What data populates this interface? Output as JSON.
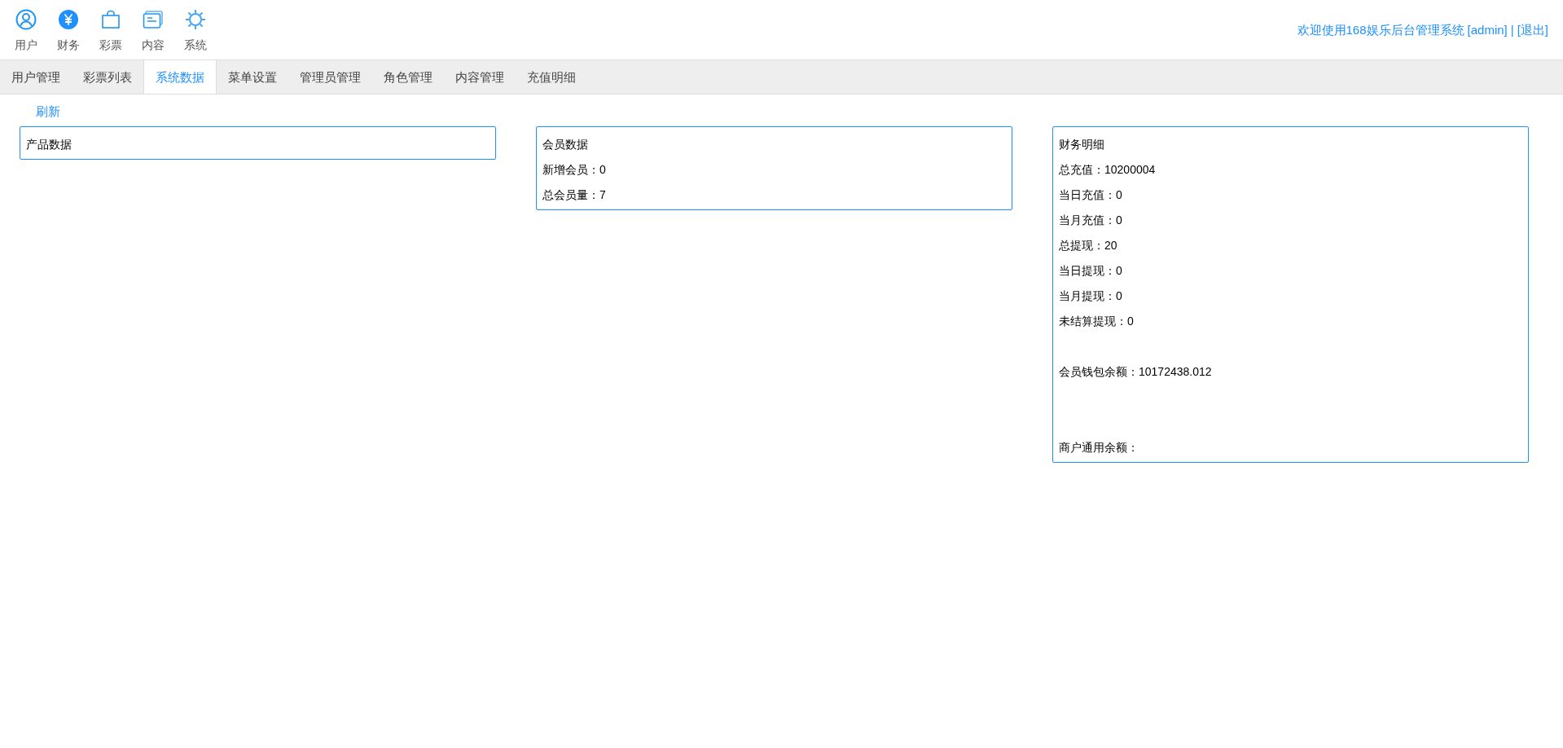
{
  "top_nav": [
    {
      "label": "用户",
      "kind": "user"
    },
    {
      "label": "财务",
      "kind": "yen"
    },
    {
      "label": "彩票",
      "kind": "bag"
    },
    {
      "label": "内容",
      "kind": "cards"
    },
    {
      "label": "系统",
      "kind": "gear"
    }
  ],
  "header": {
    "welcome": "欢迎使用168娱乐后台管理系统",
    "user": "[admin]",
    "separator": "|",
    "logout": "[退出]"
  },
  "tabs": [
    {
      "label": "用户管理",
      "selected": false
    },
    {
      "label": "彩票列表",
      "selected": false
    },
    {
      "label": "系统数据",
      "selected": true
    },
    {
      "label": "菜单设置",
      "selected": false
    },
    {
      "label": "管理员管理",
      "selected": false
    },
    {
      "label": "角色管理",
      "selected": false
    },
    {
      "label": "内容管理",
      "selected": false
    },
    {
      "label": "充值明细",
      "selected": false
    }
  ],
  "refresh": "刷新",
  "panels": [
    {
      "title": "产品数据"
    },
    {
      "title": "会员数据",
      "groups": [
        [
          {
            "label": "新增会员：",
            "value": "0"
          },
          {
            "label": "总会员量：",
            "value": "7"
          }
        ]
      ]
    },
    {
      "title": "财务明细",
      "groups": [
        [
          {
            "label": "总充值：",
            "value": "10200004"
          },
          {
            "label": "当日充值：",
            "value": "0"
          },
          {
            "label": "当月充值：",
            "value": "0"
          },
          {
            "label": "总提现：",
            "value": "20"
          },
          {
            "label": "当日提现：",
            "value": "0"
          },
          {
            "label": "当月提现：",
            "value": "0"
          },
          {
            "label": "未结算提现：",
            "value": "0"
          }
        ],
        [
          {
            "label": "会员钱包余额：",
            "value": "10172438.012"
          }
        ],
        [
          {
            "label": "商户通用余额："
          }
        ]
      ]
    }
  ]
}
